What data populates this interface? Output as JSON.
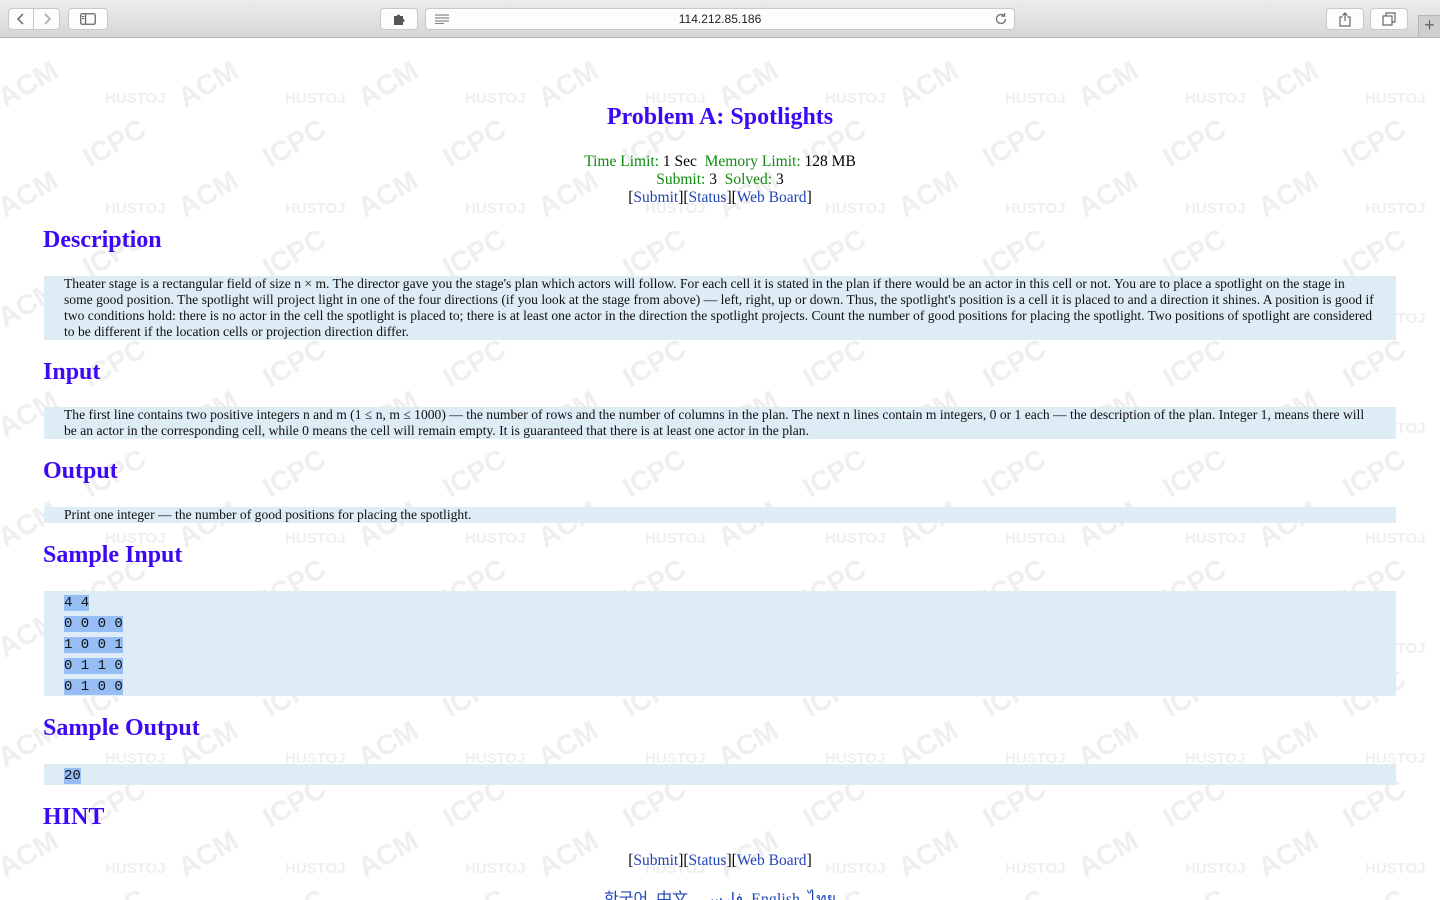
{
  "browser": {
    "url": "114.212.85.186"
  },
  "problem": {
    "title": "Problem A: Spotlights",
    "time_limit_label": "Time Limit:",
    "time_limit_value": "1 Sec",
    "memory_limit_label": "Memory Limit:",
    "memory_limit_value": "128 MB",
    "submit_label": "Submit:",
    "submit_value": "3",
    "solved_label": "Solved:",
    "solved_value": "3"
  },
  "links": {
    "submit": "Submit",
    "status": "Status",
    "web_board": "Web Board"
  },
  "sections": {
    "description_heading": "Description",
    "description_text": "Theater stage is a rectangular field of size n × m. The director gave you the stage's plan which actors will follow. For each cell it is stated in the plan if there would be an actor in this cell or not. You are to place a spotlight on the stage in some good position. The spotlight will project light in one of the four directions (if you look at the stage from above) — left, right, up or down. Thus, the spotlight's position is a cell it is placed to and a direction it shines. A position is good if two conditions hold: there is no actor in the cell the spotlight is placed to; there is at least one actor in the direction the spotlight projects. Count the number of good positions for placing the spotlight. Two positions of spotlight are considered to be different if the location cells or projection direction differ.",
    "input_heading": "Input",
    "input_text": "The first line contains two positive integers n and m (1 ≤ n, m ≤ 1000) — the number of rows and the number of columns in the plan. The next n lines contain m integers, 0 or 1 each — the description of the plan. Integer 1, means there will be an actor in the corresponding cell, while 0 means the cell will remain empty. It is guaranteed that there is at least one actor in the plan.",
    "output_heading": "Output",
    "output_text": "Print one integer — the number of good positions for placing the spotlight.",
    "sample_input_heading": "Sample Input",
    "sample_input_lines": [
      "4 4",
      "0 0 0 0",
      "1 0 0 1",
      "0 1 1 0",
      "0 1 0 0"
    ],
    "sample_output_heading": "Sample Output",
    "sample_output_lines": [
      "20"
    ],
    "hint_heading": "HINT"
  },
  "languages": [
    "한국어",
    "中文",
    "فارسی",
    "English",
    "ไทย"
  ],
  "watermark": {
    "words": [
      "ACM",
      "HUSTOJ",
      "ICPC"
    ]
  }
}
